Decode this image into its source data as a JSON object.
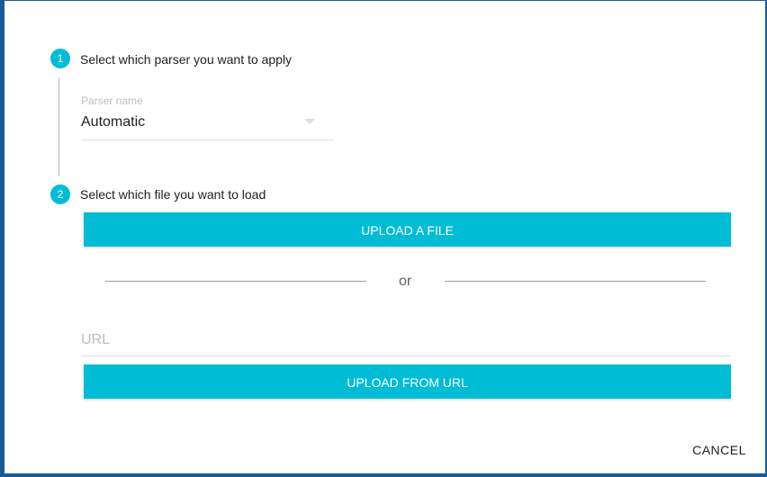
{
  "steps": [
    {
      "number": "1",
      "label": "Select which parser you want to apply"
    },
    {
      "number": "2",
      "label": "Select which file you want to load"
    }
  ],
  "parser": {
    "floating_label": "Parser name",
    "value": "Automatic"
  },
  "upload_file_label": "UPLOAD A FILE",
  "or_text": "or",
  "url": {
    "placeholder": "URL",
    "value": ""
  },
  "upload_url_label": "UPLOAD FROM URL",
  "cancel_label": "CANCEL",
  "colors": {
    "accent": "#00bcd4",
    "frame": "#1a5a96"
  }
}
